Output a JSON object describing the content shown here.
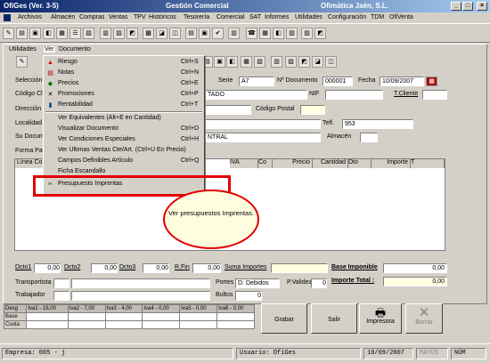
{
  "window": {
    "app": "OfiGes (Ver. 3-5)",
    "title": "Gestión Comercial",
    "company": "Ofimática Jaén, S.L."
  },
  "menubar": [
    "Archivos",
    "Almacén",
    "Compras",
    "Ventas",
    "TPV",
    "Históricos",
    "Tesorería",
    "Comercial",
    "SAT",
    "Informes",
    "Utilidades",
    "Configuración",
    "TDM",
    "OfiVenta"
  ],
  "submenubar": [
    "Utilidades",
    "Ver",
    "Documento"
  ],
  "form": {
    "seleccion": "Selección",
    "serie_label": "Serie",
    "serie": "A7",
    "ndoc_label": "Nº Documento",
    "ndoc": "000001",
    "fecha_label": "Fecha",
    "fecha": "10/09/2007",
    "codigo_label": "Código Cli",
    "cliente_name": "TADO",
    "nif_label": "NIF",
    "tcliente_label": "T.Cliente",
    "direccion_label": "Dirección",
    "cp_label": "Código Postal",
    "localidad_label": "Localidad",
    "telf_label": "Telf.",
    "telf": "953",
    "sudoc_label": "Su Documento",
    "sudoc": "NTRAL",
    "almacen_label": "Almacén",
    "formapago_label": "Forma Pago",
    "linea_label": "Línea Co"
  },
  "grid": {
    "cols": [
      "IVA",
      "Co",
      "Precio",
      "Cantidad",
      "Dto",
      "Importe",
      "T"
    ]
  },
  "menu": {
    "items": [
      {
        "label": "Riesgo",
        "shortcut": "Ctrl+S",
        "icon": "warning-icon"
      },
      {
        "label": "Notas",
        "shortcut": "Ctrl+N",
        "icon": "note-icon"
      },
      {
        "label": "Precios",
        "shortcut": "Ctrl+E",
        "icon": "price-icon"
      },
      {
        "label": "Promociones",
        "shortcut": "Ctrl+P",
        "icon": "promo-icon"
      },
      {
        "label": "Rentabilidad",
        "shortcut": "Ctrl+T",
        "icon": "chart-icon"
      },
      {
        "label": "Ver Equivalentes (Alt+E en Cantidad)",
        "shortcut": ""
      },
      {
        "label": "Visualizar Documento",
        "shortcut": "Ctrl+D"
      },
      {
        "label": "Ver Condiciones Especiales",
        "shortcut": "Ctrl+H"
      },
      {
        "label": "Ver Ultimas Ventas Cte/Art. (Ctrl+U En Precio)",
        "shortcut": ""
      },
      {
        "label": "Campos Definibles Artículo",
        "shortcut": "Ctrl+Q"
      },
      {
        "label": "Ficha Escandallo",
        "shortcut": ""
      },
      {
        "label": "Presupuesto Imprentas",
        "shortcut": "",
        "icon": "print-icon"
      }
    ]
  },
  "callout": "Ver presupuestos Imprentas.",
  "totals": {
    "dcto1": "Dcto1",
    "dcto1_v": "0,00",
    "dcto2": "Dcto2",
    "dcto2_v": "0,00",
    "dcto3": "Dcto3",
    "dcto3_v": "0,00",
    "rfin": "R.Fin",
    "rfin_v": "0,00",
    "suma": "Suma Importes",
    "base": "Base Imponible",
    "base_v": "0,00",
    "total": "Importe Total :",
    "total_v": "0,00",
    "transportista": "Transportista",
    "trabajador": "Trabajador",
    "portes": "Portes",
    "portes_v": "D: Debidos",
    "pvalidez": "P.Validez",
    "pvalidez_v": "0",
    "bultos": "Bultos",
    "bultos_v": "0"
  },
  "tax": {
    "desg": "Desg",
    "rows": [
      "Base",
      "Cuota"
    ],
    "cols": [
      "Iva1 - 16,00",
      "Iva2 - 7,00",
      "Iva3 - 4,00",
      "Iva4 - 0,00",
      "Iva5 - 0,00",
      "Iva6 - 0,00"
    ]
  },
  "buttons": {
    "grabar": "Grabar",
    "salir": "Salir",
    "impresora": "Impresora",
    "borrar": "Borrar"
  },
  "status": {
    "empresa": "Empresa: 005 - j",
    "usuario": "Usuario: OfiGes",
    "fecha": "10/09/2007",
    "mayus": "MAYÚS",
    "num": "NÚM"
  }
}
